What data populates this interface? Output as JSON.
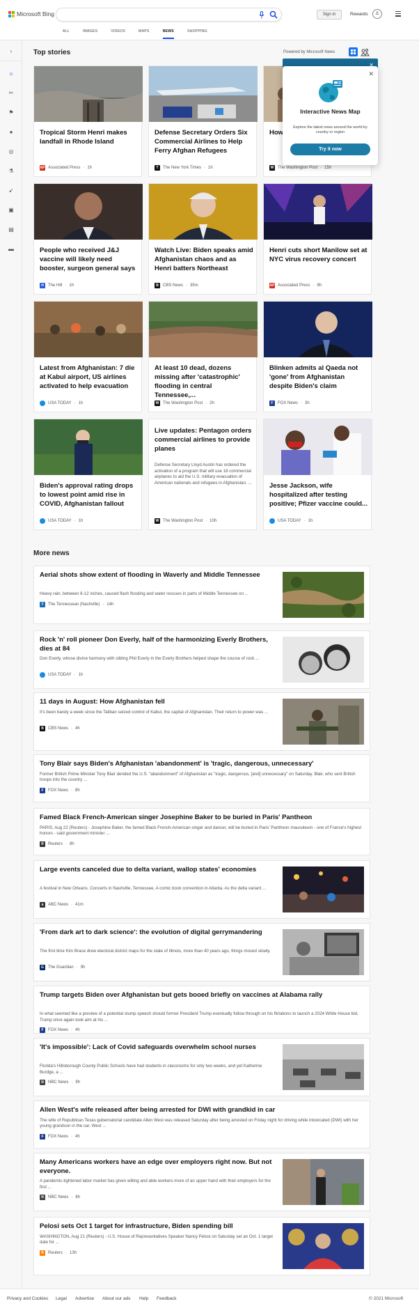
{
  "header": {
    "brand": "Microsoft Bing",
    "search_value": "",
    "signin_label": "Sign in",
    "rewards_label": "Rewards",
    "rewards_icon": "trophy-icon",
    "nav": [
      "ALL",
      "IMAGES",
      "VIDEOS",
      "MAPS",
      "NEWS",
      "SHOPPING"
    ],
    "active_nav": "NEWS",
    "logo_colors": [
      "#f25022",
      "#7fba00",
      "#00a4ef",
      "#ffb900"
    ]
  },
  "rail": {
    "icons": [
      "chevron-right-icon",
      "home-icon",
      "sports-icon",
      "flag-icon",
      "location-icon",
      "globe-icon",
      "science-icon",
      "rocket-icon",
      "entertainment-icon",
      "business-icon",
      "money-icon"
    ]
  },
  "top_stories": {
    "heading": "Top stories",
    "powered_by": "Powered by Microsoft News",
    "cards": [
      {
        "title": "Tropical Storm Henri makes landfall in Rhode Island",
        "source": "Associated Press",
        "time": "1h",
        "fav": "AP",
        "fav_color": "#d62d20",
        "img": "flood"
      },
      {
        "title": "Defense Secretary Orders Six Commercial Airlines to Help Ferry Afghan Refugees",
        "source": "The New York Times",
        "time": "1h",
        "fav": "T",
        "fav_color": "#111111",
        "img": "airport"
      },
      {
        "title": "How the Taliban...",
        "source": "The Washington Post",
        "time": "15h",
        "fav": "W",
        "fav_color": "#111111",
        "img": "crowd"
      },
      {
        "title": "People who received J&J vaccine will likely need booster, surgeon general says",
        "source": "The Hill",
        "time": "1h",
        "fav": "H",
        "fav_color": "#2e5bdc",
        "img": "surgeon"
      },
      {
        "title": "Watch Live: Biden speaks amid Afghanistan chaos and as Henri batters Northeast",
        "source": "CBS News",
        "time": "35m",
        "fav": "B",
        "fav_color": "#111111",
        "img": "biden"
      },
      {
        "title": "Henri cuts short Manilow set at NYC virus recovery concert",
        "source": "Associated Press",
        "time": "9h",
        "fav": "AP",
        "fav_color": "#d62d20",
        "img": "concert"
      },
      {
        "title": "Latest from Afghanistan: 7 die at Kabul airport, US airlines activated to help evacuation",
        "source": "USA TODAY",
        "time": "1h",
        "fav": "",
        "fav_color": "#1a8ce0",
        "img": "kabul"
      },
      {
        "title": "At least 10 dead, dozens missing after 'catastrophic' flooding in central Tennessee,...",
        "source": "The Washington Post",
        "time": "2h",
        "fav": "W",
        "fav_color": "#111111",
        "img": "tennessee"
      },
      {
        "title": "Blinken admits al Qaeda not 'gone' from Afghanistan despite Biden's claim",
        "source": "FOX News",
        "time": "3h",
        "fav": "F",
        "fav_color": "#1d3c8f",
        "img": "blinken"
      },
      {
        "title": "Biden's approval rating drops to lowest point amid rise in COVID, Afghanistan fallout",
        "source": "USA TODAY",
        "time": "1h",
        "fav": "",
        "fav_color": "#1a8ce0",
        "img": "biden2"
      },
      {
        "title": "Live updates: Pentagon orders commercial airlines to provide planes",
        "desc": "Defense Secretary Lloyd Austin has ordered the activation of a program that will use 18 commercial airplanes to aid the U.S. military evacuation of American nationals and refugees in Afghanistan. ...",
        "source": "The Washington Post",
        "time": "10h",
        "fav": "W",
        "fav_color": "#111111",
        "img": ""
      },
      {
        "title": "Jesse Jackson, wife hospitalized after testing positive; Pfizer vaccine could...",
        "source": "USA TODAY",
        "time": "1h",
        "fav": "",
        "fav_color": "#1a8ce0",
        "img": "jackson"
      }
    ]
  },
  "popup": {
    "title": "Interactive News Map",
    "desc": "Explore the latest news around the world by country or region",
    "button": "Try it now",
    "banner_button": "ow"
  },
  "more_news": {
    "heading": "More news",
    "items": [
      {
        "title": "Aerial shots show extent of flooding in Waverly and Middle Tennessee",
        "snippet": "Heavy rain, between 8-12 inches, caused flash flooding and water rescues in parts of Middle Tennessee on ...",
        "source": "The Tennessean (Nashville)",
        "time": "14h",
        "fav": "T",
        "fav_color": "#1a6bb8",
        "img": "aerial"
      },
      {
        "title": "Rock 'n' roll pioneer Don Everly, half of the harmonizing Everly Brothers, dies at 84",
        "snippet": "Don Everly, whose divine harmony with sibling Phil Everly in the Everly Brothers helped shape the course of rock ...",
        "source": "USA TODAY",
        "time": "1h",
        "fav": "",
        "fav_color": "#1a8ce0",
        "img": "everly"
      },
      {
        "title": "11 days in August: How Afghanistan fell",
        "snippet": "It's been barely a week since the Taliban seized control of Kabul, the capital of Afghanistan. Their return to power was ...",
        "source": "CBS News",
        "time": "4h",
        "fav": "B",
        "fav_color": "#111111",
        "img": "taliban"
      },
      {
        "title": "Tony Blair says Biden's Afghanistan 'abandonment' is 'tragic, dangerous, unnecessary'",
        "snippet": "Former British Prime Minister Tony Blair derided the U.S. \"abandonment\" of Afghanistan as \"tragic, dangerous, [and] unnecessary\" on Saturday.  Blair, who sent British troops into the country ...",
        "source": "FOX News",
        "time": "8h",
        "fav": "F",
        "fav_color": "#1d3c8f",
        "img": ""
      },
      {
        "title": "Famed Black French-American singer Josephine Baker to be buried in Paris' Pantheon",
        "snippet": "PARIS, Aug 22 (Reuters) - Josephine Baker, the famed Black French-American singer and dancer, will be buried in Paris' Pantheon mausoleum - one of France's highest honors - said government minister ...",
        "source": "Reuters",
        "time": "8h",
        "fav": "R",
        "fav_color": "#333333",
        "img": ""
      },
      {
        "title": "Large events canceled due to delta variant, wallop states' economies",
        "snippet": "A festival in New Orleans. Concerts in Nashville, Tennessee. A comic book convention in Atlanta. As the delta variant ...",
        "source": "ABC News",
        "time": "41m",
        "fav": "a",
        "fav_color": "#333333",
        "img": "festival"
      },
      {
        "title": "'From dark art to dark science': the evolution of digital gerrymandering",
        "snippet": "The first time Kim Brace drew electoral district maps for the state of Illinois, more than 40 years ago, things moved slowly.",
        "source": "The Guardian",
        "time": "9h",
        "fav": "G",
        "fav_color": "#052962",
        "img": "gerry"
      },
      {
        "title": "Trump targets Biden over Afghanistan but gets booed briefly on vaccines at Alabama rally",
        "snippet": "In what seemed like a preview of a potential stump speech should former President Trump eventually follow through on his flirtations to launch a 2024 White House bid, Trump once again took aim at his ...",
        "source": "FOX News",
        "time": "4h",
        "fav": "F",
        "fav_color": "#1d3c8f",
        "img": ""
      },
      {
        "title": "'It's impossible': Lack of Covid safeguards overwhelm school nurses",
        "snippet": "Florida's Hillsborough County Public Schools have had students in classrooms for only two weeks, and yet Katherine Burdge, a ...",
        "source": "NBC News",
        "time": "9h",
        "fav": "N",
        "fav_color": "#444444",
        "img": "school"
      },
      {
        "title": "Allen West's wife released after being arrested for DWI with grandkid in car",
        "snippet": "The wife of Republican Texas gubernatorial candidate Allen West was released Saturday after being arrested on Friday night for driving while intoxicated (DWI) with her young grandson in the car. West ...",
        "source": "FOX News",
        "time": "4h",
        "fav": "F",
        "fav_color": "#1d3c8f",
        "img": ""
      },
      {
        "title": "Many Americans workers have an edge over employers right now. But not everyone.",
        "snippet": "A pandemic-tightened labor market has given willing and able workers more of an upper hand with their employers for the first ...",
        "source": "NBC News",
        "time": "6h",
        "fav": "N",
        "fav_color": "#444444",
        "img": "workers"
      },
      {
        "title": "Pelosi sets Oct 1 target for infrastructure, Biden spending bill",
        "snippet": "WASHINGTON, Aug 21 (Reuters) - U.S. House of Representatives Speaker Nancy Pelosi on Saturday set an Oct. 1 target date for ...",
        "source": "Reuters",
        "time": "13h",
        "fav": "R",
        "fav_color": "#ff8000",
        "img": "pelosi"
      }
    ]
  },
  "footer": {
    "links": [
      "Privacy and Cookies",
      "Legal",
      "Advertise",
      "About our ads",
      "Help",
      "Feedback"
    ],
    "copyright": "© 2021 Microsoft"
  }
}
